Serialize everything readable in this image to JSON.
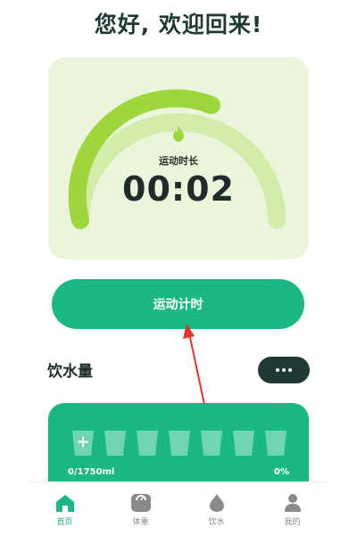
{
  "header": {
    "greeting": "您好, 欢迎回来!"
  },
  "timer": {
    "label": "运动时长",
    "value": "00:02",
    "icon": "fire-icon",
    "progress_fraction": 0.5,
    "colors": {
      "filled": "#9ed63c",
      "track": "#d3ecaa",
      "card": "#eaf5dc"
    }
  },
  "start_button": {
    "label": "运动计时"
  },
  "water": {
    "title": "饮水量",
    "more_icon": "more-dots-icon",
    "amount": "0/1750ml",
    "percent": "0%",
    "cup_count": 7,
    "add_symbol": "+",
    "colors": {
      "card": "#1cb884"
    }
  },
  "tabs": [
    {
      "label": "首页",
      "icon": "home-icon",
      "active": true
    },
    {
      "label": "体重",
      "icon": "scale-icon",
      "active": false
    },
    {
      "label": "饮水",
      "icon": "water-drop-icon",
      "active": false
    },
    {
      "label": "我的",
      "icon": "user-icon",
      "active": false
    }
  ],
  "colors": {
    "accent": "#1cb884",
    "dark": "#1f3a34",
    "annotation": "#e8322b"
  }
}
